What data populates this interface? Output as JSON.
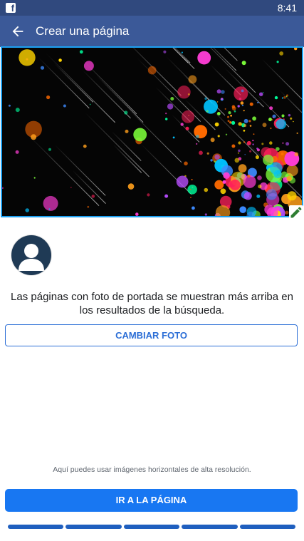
{
  "status_bar": {
    "time": "8:41",
    "app_icon": "facebook-icon"
  },
  "app_bar": {
    "title": "Crear una página",
    "back_icon": "arrow-left-icon"
  },
  "cover": {
    "edit_icon": "pencil-icon",
    "frame_color": "#1da1f2"
  },
  "profile": {
    "avatar_icon": "person-silhouette-icon"
  },
  "info_text": "Las páginas con foto de portada se muestran más arriba en los resultados de la búsqueda.",
  "change_photo_button": "CAMBIAR FOTO",
  "hint_text": "Aquí puedes usar imágenes horizontales de alta resolución.",
  "go_to_page_button": "IR A LA PÁGINA",
  "progress": {
    "steps_total": 5,
    "steps_completed": 5
  },
  "colors": {
    "status_bar": "#30497e",
    "app_bar": "#3b5998",
    "primary": "#1877f2",
    "outline_button": "#2d6fd6",
    "progress": "#1f5fbf"
  }
}
